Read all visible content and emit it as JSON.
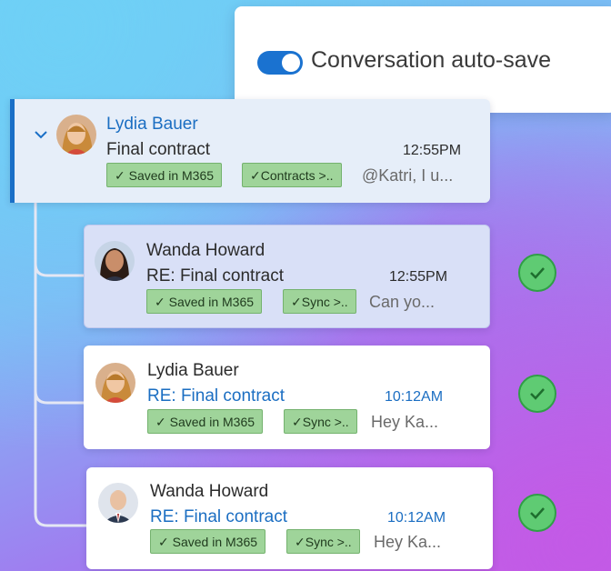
{
  "autosave": {
    "label": "Conversation auto-save",
    "enabled": true
  },
  "thread": {
    "parent": {
      "sender": "Lydia Bauer",
      "subject": "Final contract",
      "time": "12:55PM",
      "tags": [
        "✓ Saved in M365",
        "✓Contracts >.."
      ],
      "preview": "@Katri, I u..."
    },
    "replies": [
      {
        "sender": "Wanda Howard",
        "subject": "RE: Final contract",
        "time": "12:55PM",
        "tags": [
          "✓ Saved in M365",
          "✓Sync >.."
        ],
        "preview": "Can yo..."
      },
      {
        "sender": "Lydia Bauer",
        "subject": "RE: Final contract",
        "time": "10:12AM",
        "tags": [
          "✓ Saved in M365",
          "✓Sync >.."
        ],
        "preview": "Hey Ka..."
      },
      {
        "sender": "Wanda Howard",
        "subject": "RE: Final contract",
        "time": "10:12AM",
        "tags": [
          "✓ Saved in M365",
          "✓Sync >.."
        ],
        "preview": "Hey Ka..."
      }
    ]
  },
  "colors": {
    "accent": "#1a6fc7",
    "tag_bg": "#9fd49a",
    "check": "#5fcb73"
  }
}
